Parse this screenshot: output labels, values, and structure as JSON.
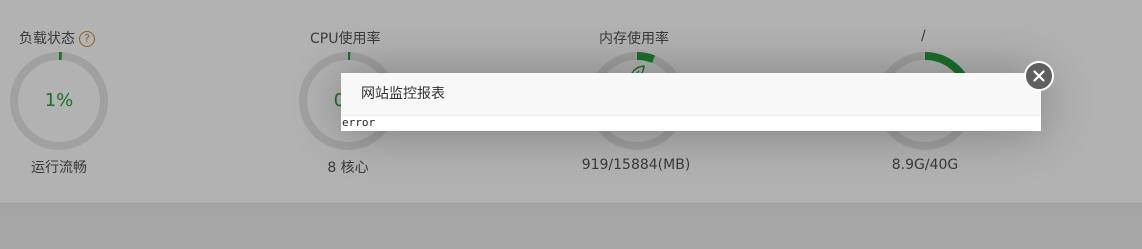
{
  "dashboard": {
    "gauges": [
      {
        "title": "负载状态",
        "value": "1%",
        "percent": 1,
        "subtitle": "运行流畅",
        "has_help": true
      },
      {
        "title": "CPU使用率",
        "value": "0.4",
        "percent": 0.4,
        "subtitle": "8 核心",
        "has_help": false
      },
      {
        "title": "内存使用率",
        "value": "",
        "percent": 6,
        "subtitle": "919/15884(MB)",
        "has_help": false
      },
      {
        "title": "/",
        "value": "",
        "percent": 22,
        "subtitle": "8.9G/40G",
        "has_help": false
      }
    ],
    "help_glyph": "?"
  },
  "modal": {
    "title": "网站监控报表",
    "body": "error",
    "close_icon": "close-icon"
  },
  "colors": {
    "ring_track": "#e5e5e5",
    "ring_fill": "#20a53a",
    "value_text": "#20a53a",
    "help_orange": "#d18a32",
    "overlay": "rgba(0,0,0,0.3)",
    "close_button": "#5f5f5f"
  }
}
